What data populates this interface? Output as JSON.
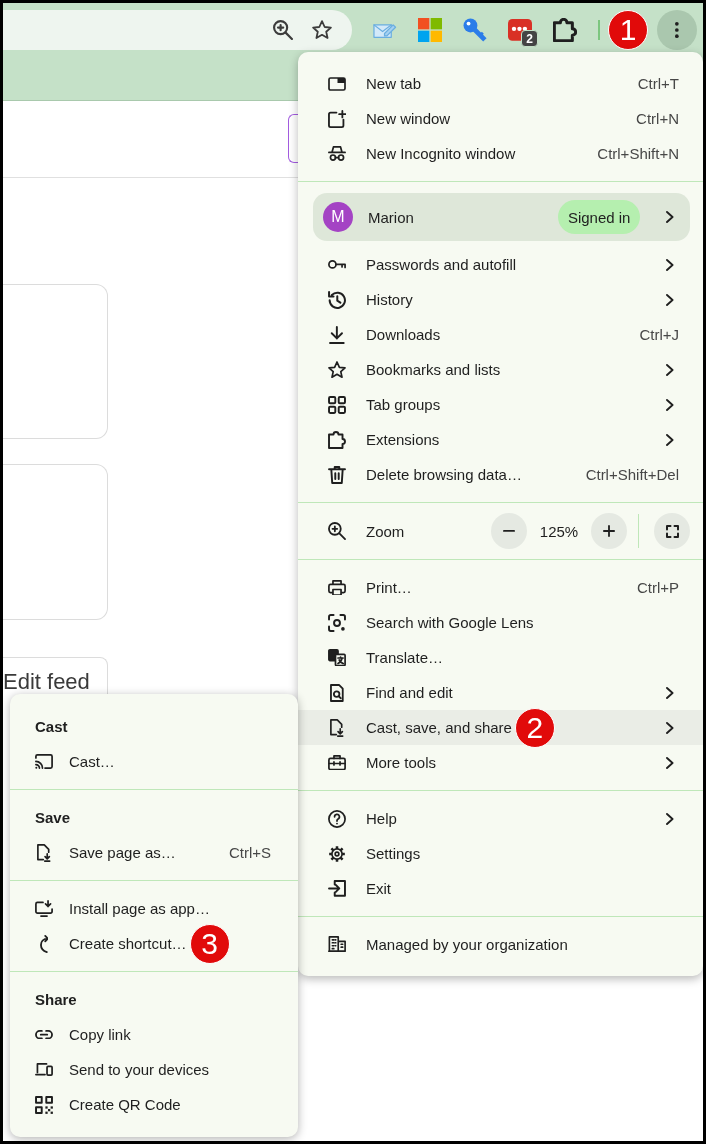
{
  "toolbar": {
    "extension_badge": "2",
    "callout": "1",
    "menu_button": {
      "pressed": true
    }
  },
  "page": {
    "button": "Edit feed"
  },
  "menu": {
    "sections": [
      {
        "items": [
          {
            "kind": "item",
            "label": "New tab",
            "shortcut": "Ctrl+T",
            "submenu": false,
            "highlighted": false
          },
          {
            "kind": "item",
            "label": "New window",
            "shortcut": "Ctrl+N",
            "submenu": false,
            "highlighted": false
          },
          {
            "kind": "item",
            "label": "New Incognito window",
            "shortcut": "Ctrl+Shift+N",
            "submenu": false,
            "highlighted": false
          }
        ]
      },
      {
        "items": [
          {
            "kind": "profile",
            "initial": "M",
            "name": "Marion",
            "status": "Signed in",
            "submenu": true,
            "highlighted": false
          },
          {
            "kind": "item",
            "label": "Passwords and autofill",
            "submenu": true,
            "highlighted": false
          },
          {
            "kind": "item",
            "label": "History",
            "submenu": true,
            "highlighted": false
          },
          {
            "kind": "item",
            "label": "Downloads",
            "shortcut": "Ctrl+J",
            "submenu": false,
            "highlighted": false
          },
          {
            "kind": "item",
            "label": "Bookmarks and lists",
            "submenu": true,
            "highlighted": false
          },
          {
            "kind": "item",
            "label": "Tab groups",
            "submenu": true,
            "highlighted": false
          },
          {
            "kind": "item",
            "label": "Extensions",
            "submenu": true,
            "highlighted": false
          },
          {
            "kind": "item",
            "label": "Delete browsing data…",
            "shortcut": "Ctrl+Shift+Del",
            "submenu": false,
            "highlighted": false
          }
        ]
      },
      {
        "items": [
          {
            "kind": "zoom",
            "label": "Zoom",
            "value": "125%"
          }
        ]
      },
      {
        "items": [
          {
            "kind": "item",
            "label": "Print…",
            "shortcut": "Ctrl+P",
            "submenu": false,
            "highlighted": false
          },
          {
            "kind": "item",
            "label": "Search with Google Lens",
            "submenu": false,
            "highlighted": false
          },
          {
            "kind": "item",
            "label": "Translate…",
            "submenu": false,
            "highlighted": false
          },
          {
            "kind": "item",
            "label": "Find and edit",
            "submenu": true,
            "highlighted": false
          },
          {
            "kind": "item",
            "label": "Cast, save, and share",
            "submenu": true,
            "highlighted": true,
            "callout": "2"
          },
          {
            "kind": "item",
            "label": "More tools",
            "submenu": true,
            "highlighted": false
          }
        ]
      },
      {
        "items": [
          {
            "kind": "item",
            "label": "Help",
            "submenu": true,
            "highlighted": false
          },
          {
            "kind": "item",
            "label": "Settings",
            "submenu": false,
            "highlighted": false
          },
          {
            "kind": "item",
            "label": "Exit",
            "submenu": false,
            "highlighted": false
          }
        ]
      },
      {
        "items": [
          {
            "kind": "item",
            "label": "Managed by your organization",
            "submenu": false,
            "highlighted": false
          }
        ]
      }
    ]
  },
  "submenu": {
    "sections": [
      {
        "heading": "Cast",
        "items": [
          {
            "label": "Cast…"
          }
        ]
      },
      {
        "heading": "Save",
        "items": [
          {
            "label": "Save page as…",
            "shortcut": "Ctrl+S"
          }
        ]
      },
      {
        "items": [
          {
            "label": "Install page as app…"
          },
          {
            "label": "Create shortcut…",
            "callout": "3"
          }
        ]
      },
      {
        "heading": "Share",
        "items": [
          {
            "label": "Copy link"
          },
          {
            "label": "Send to your devices"
          },
          {
            "label": "Create QR Code"
          }
        ]
      }
    ]
  }
}
